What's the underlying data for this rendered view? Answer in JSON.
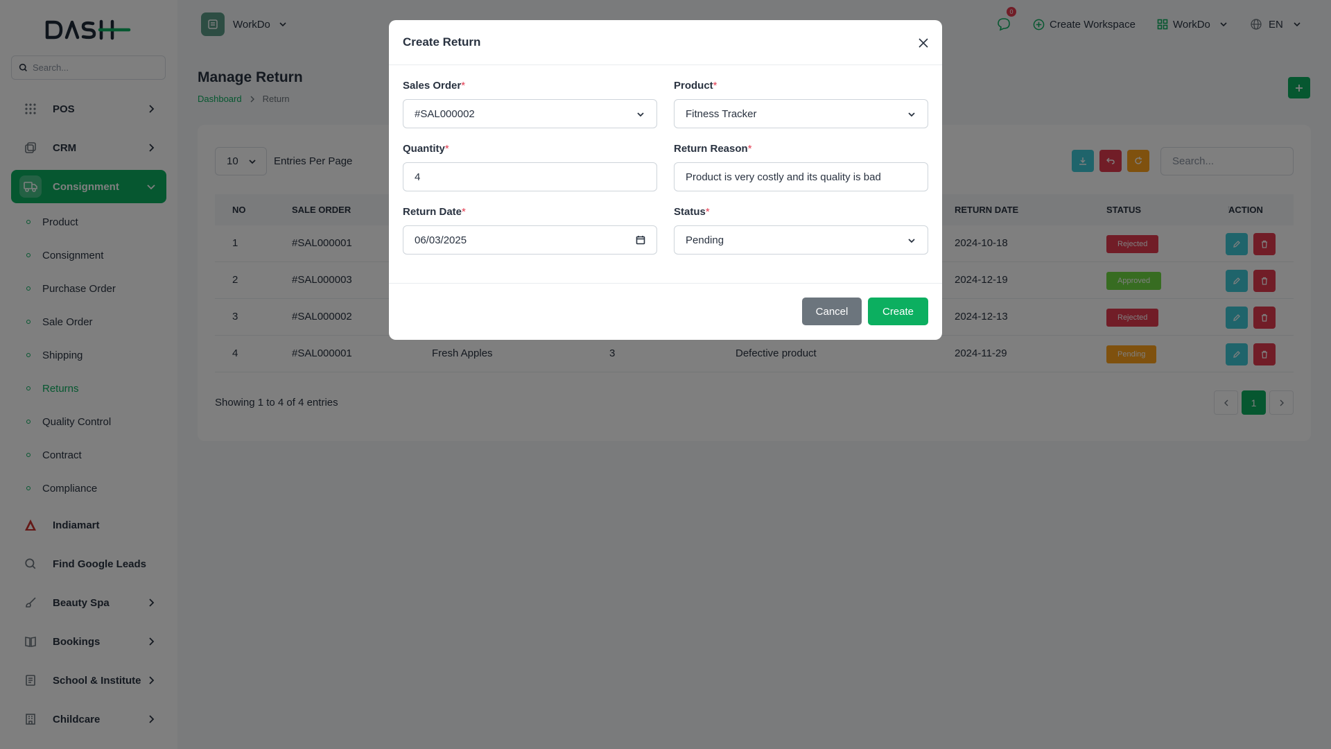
{
  "sidebar": {
    "search_placeholder": "Search...",
    "items": [
      {
        "label": "POS",
        "icon": "grid-icon"
      },
      {
        "label": "CRM",
        "icon": "layers-icon"
      },
      {
        "label": "Consignment",
        "icon": "truck-icon"
      },
      {
        "label": "Indiamart",
        "icon": "indiamart-logo-icon"
      },
      {
        "label": "Find Google Leads",
        "icon": "search-icon"
      },
      {
        "label": "Beauty Spa",
        "icon": "brush-icon"
      },
      {
        "label": "Bookings",
        "icon": "book-icon"
      },
      {
        "label": "School & Institute",
        "icon": "notebook-icon"
      },
      {
        "label": "Childcare",
        "icon": "building-icon"
      }
    ],
    "sub_items": [
      "Product",
      "Consignment",
      "Purchase Order",
      "Sale Order",
      "Shipping",
      "Returns",
      "Quality Control",
      "Contract",
      "Compliance"
    ]
  },
  "header": {
    "workspace": "WorkDo",
    "notification_count": "0",
    "create_workspace": "Create Workspace",
    "company": "WorkDo",
    "language": "EN"
  },
  "page": {
    "title": "Manage Return",
    "breadcrumb": [
      "Dashboard",
      "Return"
    ]
  },
  "table": {
    "per_page": "10",
    "per_page_label": "Entries Per Page",
    "search_placeholder": "Search...",
    "columns": [
      "NO",
      "SALE ORDER",
      "RETURN DATE",
      "STATUS",
      "ACTION"
    ],
    "rows": [
      {
        "no": "1",
        "sale_order": "#SAL000001",
        "product": "",
        "quantity": "",
        "reason": "",
        "return_date": "2024-10-18",
        "status": "Rejected"
      },
      {
        "no": "2",
        "sale_order": "#SAL000003",
        "product": "",
        "quantity": "",
        "reason": "",
        "return_date": "2024-12-19",
        "status": "Approved"
      },
      {
        "no": "3",
        "sale_order": "#SAL000002",
        "product": "",
        "quantity": "",
        "reason": "",
        "return_date": "2024-12-13",
        "status": "Rejected"
      },
      {
        "no": "4",
        "sale_order": "#SAL000001",
        "product": "Fresh Apples",
        "quantity": "3",
        "reason": "Defective product",
        "return_date": "2024-11-29",
        "status": "Pending"
      }
    ],
    "showing": "Showing 1 to 4 of 4 entries",
    "current_page": "1"
  },
  "modal": {
    "title": "Create Return",
    "fields": {
      "sales_order": {
        "label": "Sales Order",
        "value": "#SAL000002"
      },
      "product": {
        "label": "Product",
        "value": "Fitness Tracker"
      },
      "quantity": {
        "label": "Quantity",
        "value": "4"
      },
      "return_reason": {
        "label": "Return Reason",
        "value": "Product is very costly and its quality is bad"
      },
      "return_date": {
        "label": "Return Date",
        "value": "06/03/2025"
      },
      "status": {
        "label": "Status",
        "value": "Pending"
      }
    },
    "required_mark": "*",
    "cancel": "Cancel",
    "create": "Create"
  },
  "colors": {
    "primary": "#0caf60",
    "rejected": "#e23a4f",
    "approved": "#6fd943",
    "pending": "#ffa21d",
    "info": "#3ec9d6"
  }
}
